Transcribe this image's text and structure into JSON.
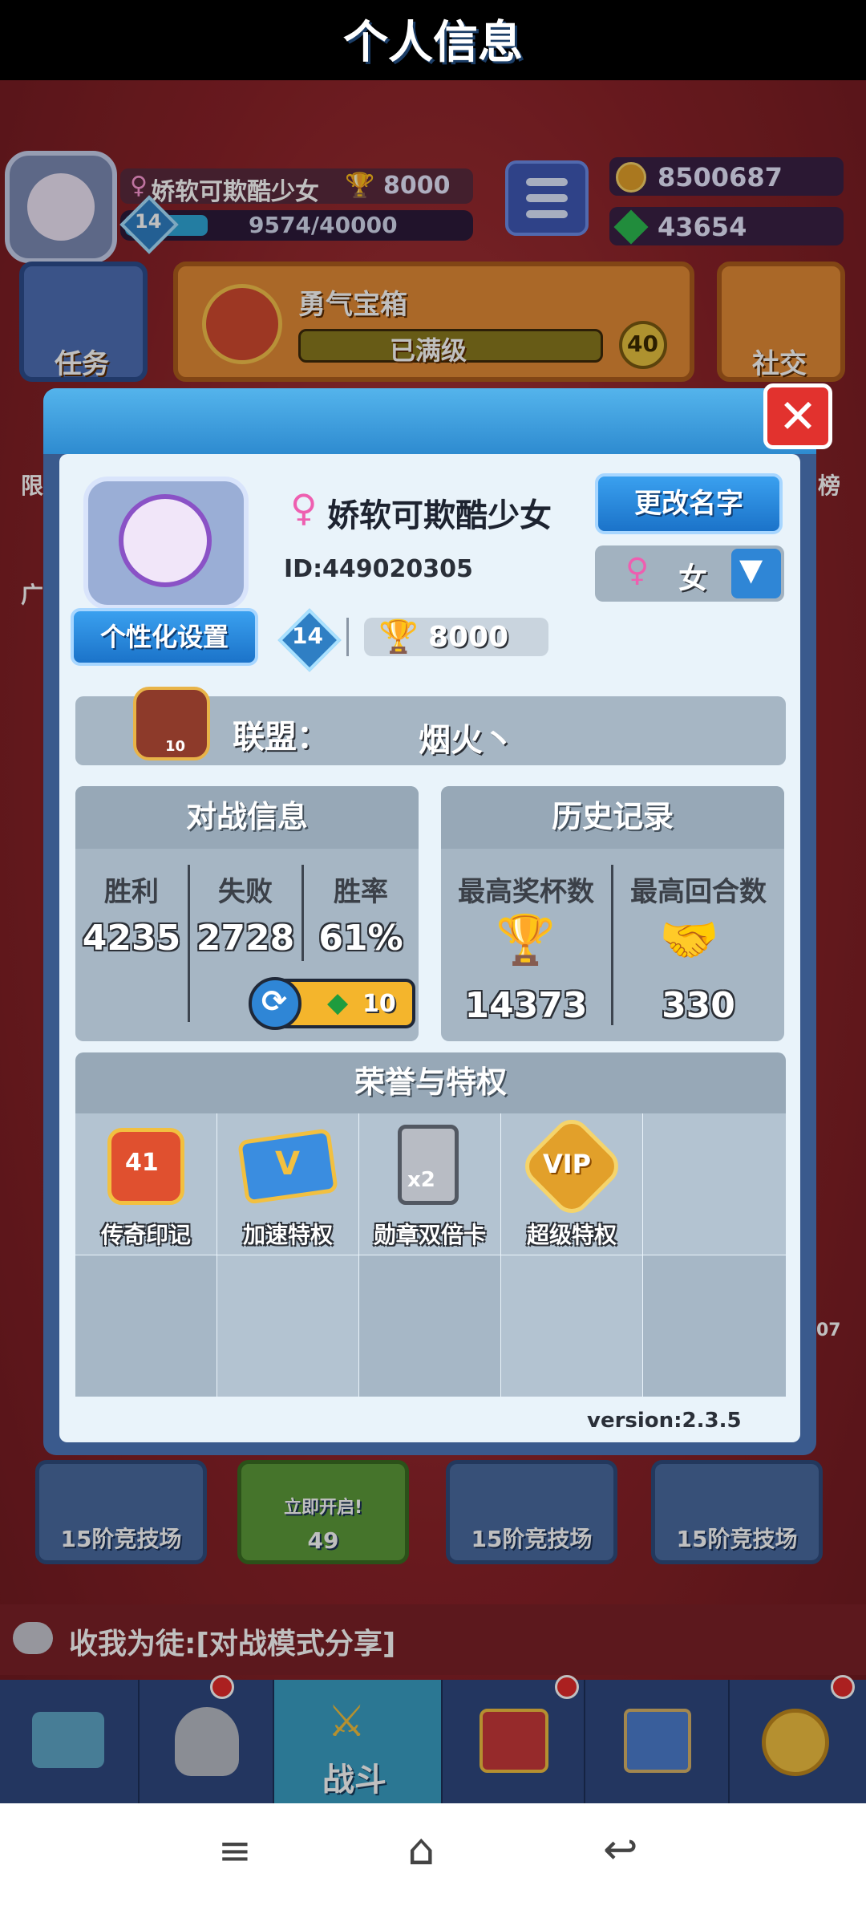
{
  "hud": {
    "player_name": "娇软可欺酷少女",
    "trophies": "8000",
    "level": "14",
    "xp": "9574/40000",
    "xp_fraction": 0.24,
    "gold": "8500687",
    "gems": "43654"
  },
  "cards": {
    "task": "任务",
    "chest_title": "勇气宝箱",
    "chest_status": "已满级",
    "chest_count": "40",
    "social": "社交"
  },
  "side": {
    "left1": "限",
    "left2": "广",
    "right1": "榜",
    "right2": "07"
  },
  "modal": {
    "title": "个人信息",
    "close": "✕",
    "name": "娇软可欺酷少女",
    "id": "ID:449020305",
    "rename_button": "更改名字",
    "gender": "女",
    "custom_button": "个性化设置",
    "level": "14",
    "trophies": "8000",
    "alliance_label": "联盟：",
    "alliance_name": "烟火丶",
    "alliance_level": "10",
    "battle": {
      "title": "对战信息",
      "win_label": "胜利",
      "lose_label": "失败",
      "rate_label": "胜率",
      "wins": "4235",
      "losses": "2728",
      "rate": "61%",
      "reset_cost": "10"
    },
    "history": {
      "title": "历史记录",
      "max_trophies_label": "最高奖杯数",
      "max_rounds_label": "最高回合数",
      "max_trophies": "14373",
      "max_rounds": "330"
    },
    "honor": {
      "title": "荣誉与特权",
      "items": [
        {
          "label": "传奇印记",
          "badge": "41"
        },
        {
          "label": "加速特权",
          "badge": "V"
        },
        {
          "label": "勋章双倍卡",
          "badge": "x2"
        },
        {
          "label": "超级特权",
          "badge": "VIP"
        }
      ]
    },
    "version": "version:2.3.5"
  },
  "arena": {
    "chest1": "15阶竞技场",
    "open_now": "立即开启!",
    "open_cost": "49",
    "chest3": "15阶竞技场",
    "chest4": "15阶竞技场"
  },
  "chat": {
    "message": "收我为徒:[对战模式分享]"
  },
  "tabs": {
    "battle": "战斗"
  },
  "colors": {
    "accent_blue": "#2e8bd0",
    "close_red": "#e2322e",
    "background_red": "#8a2228"
  }
}
